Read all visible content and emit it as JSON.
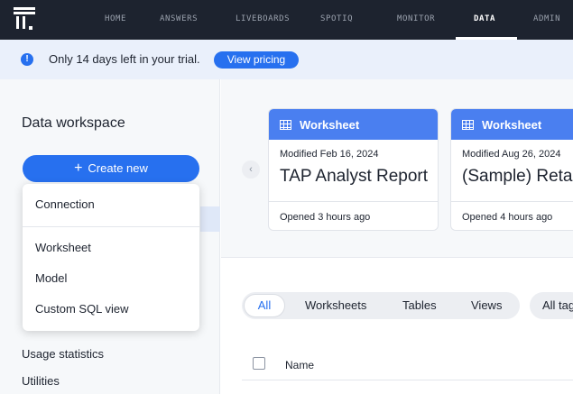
{
  "nav": {
    "items": [
      "HOME",
      "ANSWERS",
      "LIVEBOARDS",
      "SPOTIQ",
      "MONITOR",
      "DATA",
      "ADMIN"
    ],
    "active": "DATA"
  },
  "banner": {
    "text": "Only 14 days left in your trial.",
    "button": "View pricing",
    "icon": "info-icon"
  },
  "sidebar": {
    "title": "Data workspace",
    "create_button": "Create new",
    "create_icon": "plus-icon",
    "menu": [
      "Connection",
      "Worksheet",
      "Model",
      "Custom SQL view"
    ],
    "links": [
      "Usage statistics",
      "Utilities"
    ]
  },
  "cards": [
    {
      "type": "Worksheet",
      "modified": "Modified Feb 16, 2024",
      "title": "TAP Analyst Report",
      "opened": "Opened 3 hours ago"
    },
    {
      "type": "Worksheet",
      "modified": "Modified Aug 26, 2024",
      "title": "(Sample) Retail",
      "opened": "Opened 4 hours ago"
    }
  ],
  "filters": {
    "active": "All",
    "tabs": [
      "Worksheets",
      "Tables",
      "Views"
    ],
    "all_tags": "All tags"
  },
  "table": {
    "column_name": "Name"
  },
  "colors": {
    "nav_bg": "#1d232f",
    "accent": "#2770ef",
    "card_header": "#4a7ff0",
    "banner_bg": "#eaf0fb"
  }
}
